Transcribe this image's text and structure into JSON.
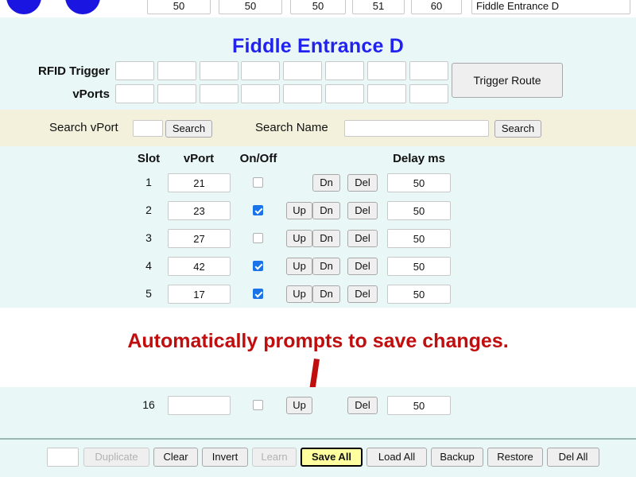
{
  "window": {
    "bg_mint": "#e9f8f6",
    "bg_cream": "#f3f0dc",
    "accent_blue": "#2222ee",
    "annotation_red": "#c00d0d",
    "highlight_yellow": "#ffffa0"
  },
  "top_partial_row": {
    "icons": [
      "blue-circle-icon",
      "blue-circle-icon"
    ],
    "fields": [
      "50",
      "50",
      "50",
      "51",
      "60"
    ],
    "name_field": "Fiddle Entrance D"
  },
  "header": {
    "title": "Fiddle Entrance D",
    "rfid_trigger_label": "RFID Trigger",
    "vports_label": "vPorts",
    "rfid_trigger_values": [
      "",
      "",
      "",
      "",
      "",
      "",
      "",
      ""
    ],
    "vports_values": [
      "",
      "",
      "",
      "",
      "",
      "",
      "",
      ""
    ],
    "trigger_route_button": "Trigger Route"
  },
  "search": {
    "vport_label": "Search vPort",
    "vport_value": "",
    "vport_search_button": "Search",
    "name_label": "Search Name",
    "name_value": "",
    "name_search_button": "Search"
  },
  "table": {
    "headers": {
      "slot": "Slot",
      "vport": "vPort",
      "onoff": "On/Off",
      "delay": "Delay ms"
    },
    "buttons": {
      "up": "Up",
      "dn": "Dn",
      "del": "Del"
    },
    "rows": [
      {
        "slot": "1",
        "vport": "21",
        "checked": false,
        "has_up": false,
        "has_dn": true,
        "delay": "50"
      },
      {
        "slot": "2",
        "vport": "23",
        "checked": true,
        "has_up": true,
        "has_dn": true,
        "delay": "50"
      },
      {
        "slot": "3",
        "vport": "27",
        "checked": false,
        "has_up": true,
        "has_dn": true,
        "delay": "50"
      },
      {
        "slot": "4",
        "vport": "42",
        "checked": true,
        "has_up": true,
        "has_dn": true,
        "delay": "50"
      },
      {
        "slot": "5",
        "vport": "17",
        "checked": true,
        "has_up": true,
        "has_dn": true,
        "delay": "50"
      }
    ],
    "last_row": {
      "slot": "16",
      "vport": "",
      "checked": false,
      "has_up": true,
      "has_dn": false,
      "delay": "50"
    }
  },
  "annotation": {
    "text": "Automatically prompts to save changes.",
    "arrow": "down-arrow-icon"
  },
  "toolbar": {
    "count_value": "",
    "buttons": [
      {
        "label": "Duplicate",
        "disabled": true,
        "highlight": false
      },
      {
        "label": "Clear",
        "disabled": false,
        "highlight": false
      },
      {
        "label": "Invert",
        "disabled": false,
        "highlight": false
      },
      {
        "label": "Learn",
        "disabled": true,
        "highlight": false
      },
      {
        "label": "Save All",
        "disabled": false,
        "highlight": true
      },
      {
        "label": "Load All",
        "disabled": false,
        "highlight": false
      },
      {
        "label": "Backup",
        "disabled": false,
        "highlight": false
      },
      {
        "label": "Restore",
        "disabled": false,
        "highlight": false
      },
      {
        "label": "Del All",
        "disabled": false,
        "highlight": false
      }
    ]
  }
}
